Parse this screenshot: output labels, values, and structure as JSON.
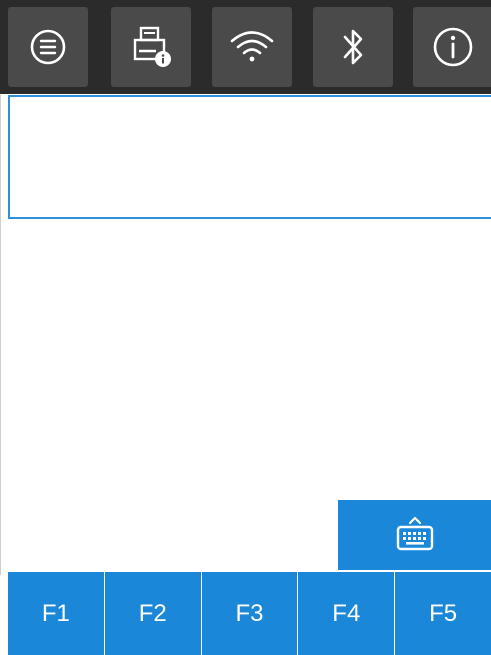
{
  "toolbar": {
    "buttons": [
      {
        "icon": "menu-icon"
      },
      {
        "icon": "printer-info-icon"
      },
      {
        "icon": "wifi-icon"
      },
      {
        "icon": "bluetooth-icon"
      },
      {
        "icon": "info-icon"
      }
    ]
  },
  "input": {
    "value": "",
    "placeholder": ""
  },
  "keyboard_button": {
    "icon": "keyboard-icon"
  },
  "function_keys": [
    {
      "label": "F1"
    },
    {
      "label": "F2"
    },
    {
      "label": "F3"
    },
    {
      "label": "F4"
    },
    {
      "label": "F5"
    }
  ],
  "colors": {
    "toolbar_bg": "#2b2b2b",
    "toolbar_button_bg": "#4a4a4a",
    "icon_color": "#ffffff",
    "accent_blue": "#1a87d8",
    "input_border": "#2f8fd8"
  }
}
